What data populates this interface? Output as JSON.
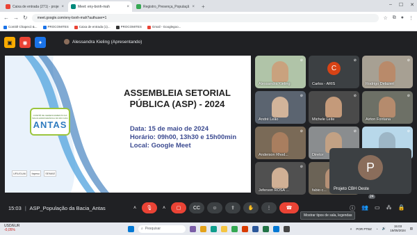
{
  "browser": {
    "tabs": [
      {
        "label": "Caixa de entrada (271) - proje",
        "color": "#ea4335",
        "active": false
      },
      {
        "label": "Meet: eny-bxnh-mah",
        "color": "#00897b",
        "active": true
      },
      {
        "label": "Registro_Presença_Populaçã",
        "color": "#34a853",
        "active": false
      }
    ],
    "tab_close": "×",
    "url": "meet.google.com/eny-bxnh-mah?authuser=1",
    "bookmarks": [
      "Comitê Chapecó &...",
      "PROCOMITES",
      "Caixa de entrada (1)...",
      "PROCOMITES",
      "Gmail - Googlegoo..."
    ]
  },
  "meet": {
    "presenter": "Alessandra Kieling (Apresentando)",
    "slide": {
      "logo_small": "COMITÊ DE GERENCIAMENTO DA BACIA HIDROGRÁFICA DO RIO DAS",
      "logo_big": "ANTAS",
      "title_line1": "ASSEMBLEIA SETORIAL",
      "title_line2": "PÚBLICA (ASP) - 2024",
      "date": "Data: 15 de maio de 2024",
      "hours": "Horário: 09h00, 13h30 e 15h00min",
      "place": "Local: Google Meet",
      "partner_logos": [
        "URUGUAI",
        "fapesc",
        "SEMAE"
      ]
    },
    "participants": [
      {
        "name": "Alessandra Kieling",
        "color": "#b0c4a8",
        "skin": "#c9a27e"
      },
      {
        "name": "Carlos - ARIS",
        "color": "#3c4043",
        "initial": "C",
        "avatar": "#d84315"
      },
      {
        "name": "Rodrigo Delazeri",
        "color": "#a7a093",
        "skin": "#b98a6a"
      },
      {
        "name": "André Leão",
        "color": "#5b6470",
        "skin": "#d2b49a"
      },
      {
        "name": "Michele Leite",
        "color": "#4a4a4a",
        "skin": "#c49a7a"
      },
      {
        "name": "Airton Fontana",
        "color": "#6d7066",
        "skin": "#b58b6d"
      },
      {
        "name": "Anderson Rhod...",
        "color": "#7a6a57",
        "skin": "#a97e5f"
      },
      {
        "name": "Diretor",
        "color": "#8a8d8f",
        "skin": "#c2a184"
      },
      {
        "name": "",
        "color": "#b8d8ea",
        "skin": "#9db6c6"
      },
      {
        "name": "Jeferson ROSA ...",
        "color": "#505050",
        "skin": "#d0b095"
      },
      {
        "name": "fabio c...",
        "color": "#6b6356",
        "skin": "#b59075"
      }
    ],
    "big_tile": {
      "initial": "P",
      "name": "Projeto CBH Oeste"
    },
    "tooltip": "Mostrar tipos de sala, legendas",
    "time": "15:03",
    "meeting_name": "ASP_População da Bacia_Antas",
    "participant_count": "24"
  },
  "taskbar": {
    "ticker": "USD/EUR",
    "change": "-0,05%",
    "search_placeholder": "Pesquisar",
    "lang": "POR PTBZ",
    "time": "15:03",
    "date": "15/05/2024"
  }
}
